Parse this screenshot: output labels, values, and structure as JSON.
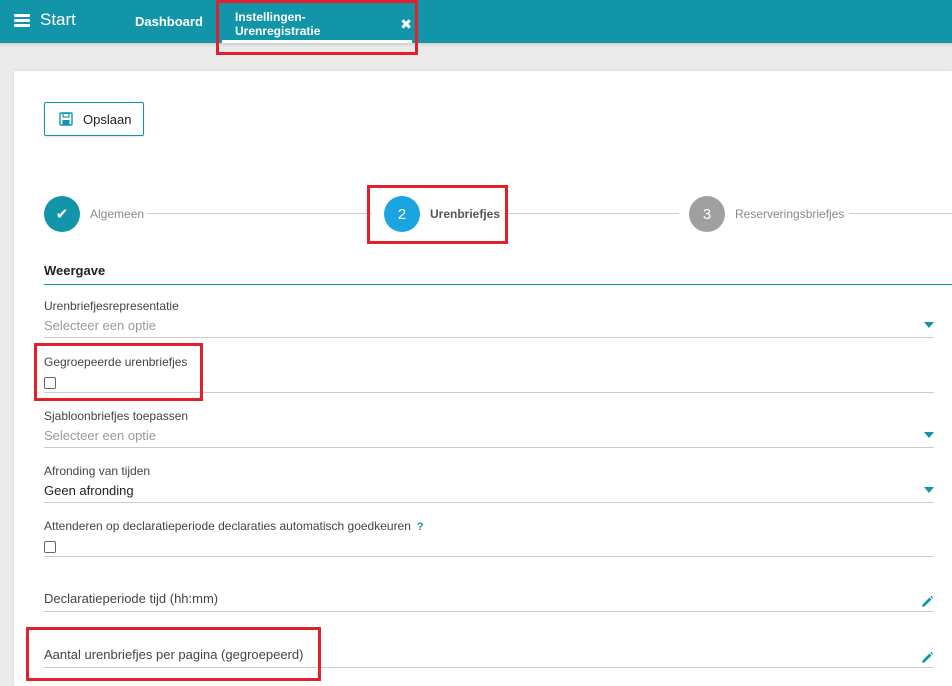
{
  "app": {
    "start_label": "Start",
    "tabs": [
      {
        "label": "Dashboard"
      },
      {
        "label": "Instellingen-Urenregistratie",
        "close_glyph": "✖"
      }
    ]
  },
  "toolbar": {
    "save_label": "Opslaan",
    "save_icon": "floppy-disk-icon"
  },
  "stepper": {
    "steps": [
      {
        "marker": "✔",
        "label": "Algemeen",
        "state": "done",
        "color": "#1295a8"
      },
      {
        "marker": "2",
        "label": "Urenbriefjes",
        "state": "active",
        "color": "#1aa5e0"
      },
      {
        "marker": "3",
        "label": "Reserveringsbriefjes",
        "state": "pending",
        "color": "#a0a0a0"
      }
    ]
  },
  "section": {
    "title": "Weergave"
  },
  "fields": {
    "representatie": {
      "label": "Urenbriefjesrepresentatie",
      "placeholder": "Selecteer een optie"
    },
    "gegroepeerd": {
      "label": "Gegroepeerde urenbriefjes"
    },
    "sjabloon": {
      "label": "Sjabloonbriefjes toepassen",
      "placeholder": "Selecteer een optie"
    },
    "afronding": {
      "label": "Afronding van tijden",
      "value": "Geen afronding"
    },
    "attenderen": {
      "label": "Attenderen op declaratieperiode declaraties automatisch goedkeuren",
      "help": "?"
    },
    "declaratie_tijd": {
      "label": "Declaratieperiode tijd (hh:mm)"
    },
    "aantal_per_pagina": {
      "label": "Aantal urenbriefjes per pagina (gegroepeerd)"
    }
  },
  "colors": {
    "accent": "#1295a8",
    "highlight": "#e0202b"
  }
}
